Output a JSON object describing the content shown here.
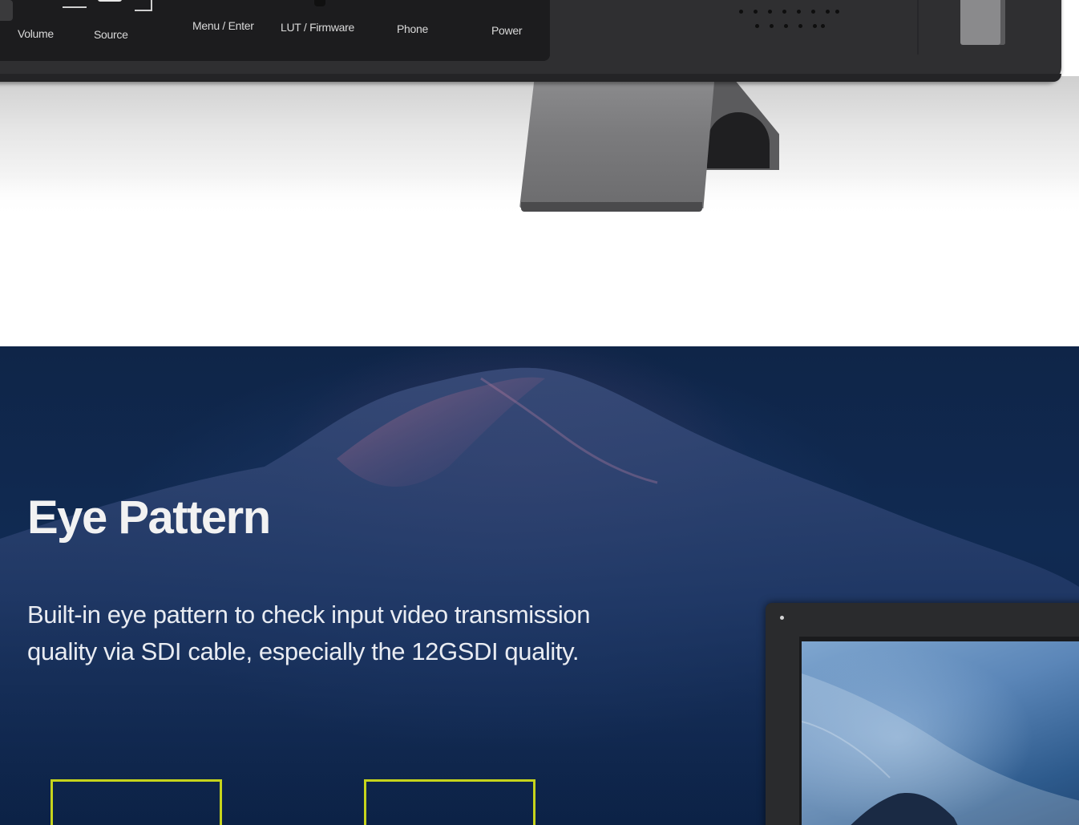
{
  "controls": {
    "volume_label": "Volume",
    "source_label": "Source",
    "menu_label": "Menu / Enter",
    "lut_label": "LUT / Firmware",
    "phone_label": "Phone",
    "power_label": "Power"
  },
  "eye_pattern": {
    "title": "Eye Pattern",
    "description": "Built-in eye pattern to check input video transmission quality via SDI cable, especially the 12GSDI quality."
  },
  "colors": {
    "accent_frame": "#c6d41c",
    "section_bg": "#102a52",
    "monitor_body": "#2f2f31"
  }
}
